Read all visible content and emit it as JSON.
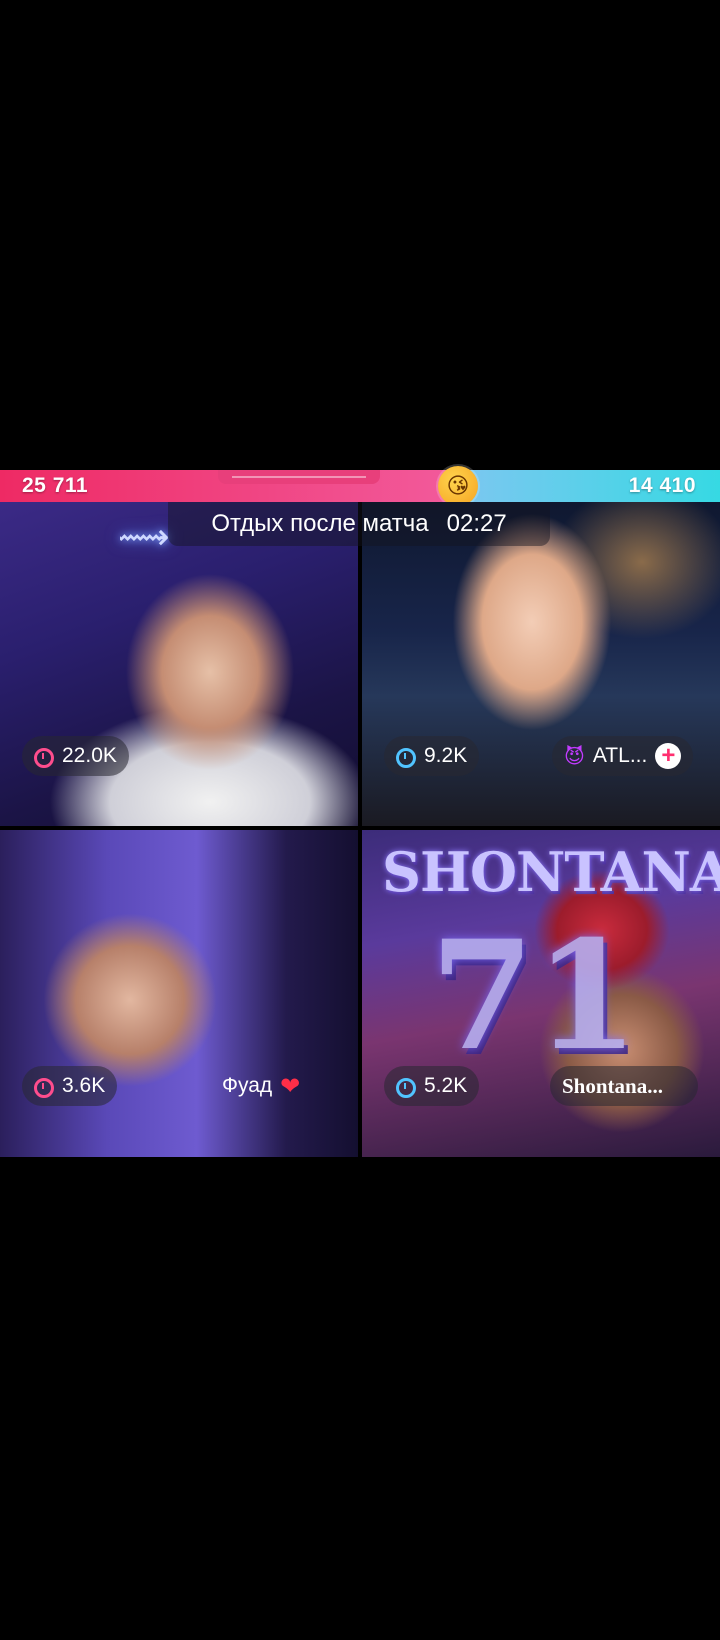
{
  "battle": {
    "left_score": "25 711",
    "right_score": "14 410",
    "left_fraction": 0.64,
    "emoji": "😘",
    "colors": {
      "left": "#ee2a64",
      "right": "#36d9e3"
    }
  },
  "topic": {
    "title": "Отдых после матча",
    "timer": "02:27"
  },
  "tiles": [
    {
      "viewers": "22.0K",
      "viewer_icon": "alarm-icon",
      "accent": "#ff4d8d",
      "name": ""
    },
    {
      "viewers": "9.2K",
      "viewer_icon": "alarm-icon",
      "accent": "#51c4ff",
      "name": "ATL...",
      "name_icon": "devil-icon",
      "action": "+"
    },
    {
      "viewers": "3.6K",
      "viewer_icon": "alarm-icon",
      "accent": "#ff4d8d",
      "name": "Фуад",
      "name_icon": "heart-icon",
      "heart": "❤"
    },
    {
      "viewers": "5.2K",
      "viewer_icon": "alarm-icon",
      "accent": "#51c4ff",
      "name": "Shontana..."
    }
  ],
  "backgrounds": {
    "neon_sign": "shark-icon",
    "poster_title": "SHONTANA",
    "poster_number": "71"
  }
}
